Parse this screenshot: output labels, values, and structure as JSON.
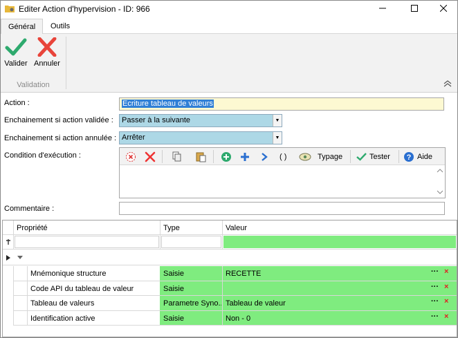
{
  "window": {
    "title": "Editer Action d'hypervision - ID: 966"
  },
  "tabs": [
    {
      "label": "Général"
    },
    {
      "label": "Outils"
    }
  ],
  "ribbon": {
    "validate_label": "Valider",
    "cancel_label": "Annuler",
    "group_label": "Validation"
  },
  "form": {
    "action_label": "Action :",
    "action_value": "Ecriture tableau de valeurs",
    "on_valid_label": "Enchainement si action validée :",
    "on_valid_value": "Passer à la suivante",
    "on_cancel_label": "Enchainement si action annulée :",
    "on_cancel_value": "Arrêter",
    "condition_label": "Condition d'exécution :",
    "comment_label": "Commentaire :",
    "comment_value": ""
  },
  "condition_toolbar": {
    "typage_label": "Typage",
    "tester_label": "Tester",
    "aide_label": "Aide",
    "parens_label": "( )"
  },
  "grid": {
    "headers": [
      "Propriété",
      "Type",
      "Valeur"
    ],
    "rows": [
      {
        "prop": "Mnémonique structure",
        "type": "Saisie",
        "value": "RECETTE"
      },
      {
        "prop": "Code API du tableau de valeur",
        "type": "Saisie",
        "value": ""
      },
      {
        "prop": "Tableau de valeurs",
        "type": "Parametre Syno...",
        "value": "Tableau de valeur"
      },
      {
        "prop": "Identification active",
        "type": "Saisie",
        "value": "Non - 0"
      }
    ],
    "row_action_dots": "···",
    "row_action_delete": "×"
  },
  "colors": {
    "accent_green": "#7fec7f",
    "combo_blue": "#add8e6",
    "validate_green": "#2eaa6e",
    "cancel_red": "#e8443a"
  }
}
